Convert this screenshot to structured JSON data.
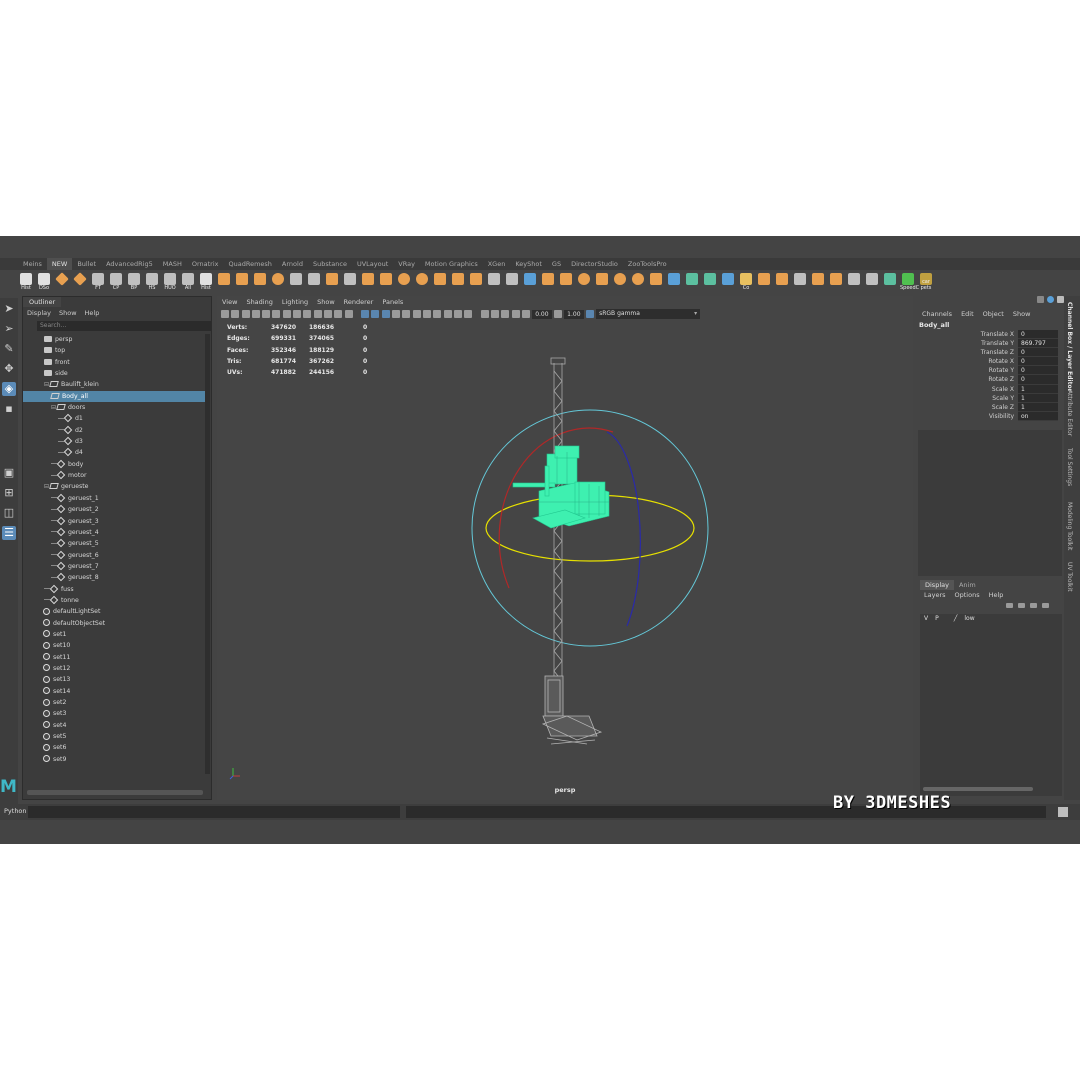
{
  "shelf_tabs": [
    "Meins",
    "NEW",
    "Bullet",
    "AdvancedRig5",
    "MASH",
    "Ornatrix",
    "QuadRemesh",
    "Arnold",
    "Substance",
    "UVLayout",
    "VRay",
    "Motion Graphics",
    "XGen",
    "KeyShot",
    "GS",
    "DirectorStudio",
    "ZooToolsPro"
  ],
  "active_shelf_tab": "NEW",
  "shelf_icons": [
    {
      "name": "hist-icon",
      "label": "Hist",
      "color": "#e0e0e0"
    },
    {
      "name": "dso-icon",
      "label": "DSo",
      "color": "#e0e0e0"
    },
    {
      "name": "diamond-icon",
      "label": "",
      "color": "#e8a050"
    },
    {
      "name": "diamond-icon",
      "label": "",
      "color": "#e8a050"
    },
    {
      "name": "ft-icon",
      "label": "FT",
      "color": "#c0c0c0"
    },
    {
      "name": "cp-icon",
      "label": "CP",
      "color": "#c0c0c0"
    },
    {
      "name": "bp-icon",
      "label": "BP",
      "color": "#c0c0c0"
    },
    {
      "name": "hs-icon",
      "label": "HS",
      "color": "#c0c0c0"
    },
    {
      "name": "huo-icon",
      "label": "HUO",
      "color": "#c0c0c0"
    },
    {
      "name": "all-icon",
      "label": "All",
      "color": "#c0c0c0"
    },
    {
      "name": "hist-icon",
      "label": "Hist",
      "color": "#e0e0e0"
    },
    {
      "name": "curve-icon",
      "label": "",
      "color": "#e8a050"
    },
    {
      "name": "cube-icon",
      "label": "",
      "color": "#e8a050"
    },
    {
      "name": "cube-icon",
      "label": "",
      "color": "#e8a050"
    },
    {
      "name": "sphere-icon",
      "label": "",
      "color": "#e8a050"
    },
    {
      "name": "grid-icon",
      "label": "",
      "color": "#c0c0c0"
    },
    {
      "name": "grid-icon",
      "label": "",
      "color": "#c0c0c0"
    },
    {
      "name": "bevel-icon",
      "label": "",
      "color": "#e8a050"
    },
    {
      "name": "grid-icon",
      "label": "",
      "color": "#c0c0c0"
    },
    {
      "name": "bridge-icon",
      "label": "",
      "color": "#e8a050"
    },
    {
      "name": "bridge-icon",
      "label": "",
      "color": "#e8a050"
    },
    {
      "name": "sphere-icon",
      "label": "",
      "color": "#e8a050"
    },
    {
      "name": "sphere-icon",
      "label": "",
      "color": "#e8a050"
    },
    {
      "name": "cube-icon",
      "label": "",
      "color": "#e8a050"
    },
    {
      "name": "cube-icon",
      "label": "",
      "color": "#e8a050"
    },
    {
      "name": "plane-icon",
      "label": "",
      "color": "#e8a050"
    },
    {
      "name": "plane-icon",
      "label": "",
      "color": "#c0c0c0"
    },
    {
      "name": "grid-icon",
      "label": "",
      "color": "#c0c0c0"
    },
    {
      "name": "pipe-icon",
      "label": "",
      "color": "#5aa0d8"
    },
    {
      "name": "cube-icon",
      "label": "",
      "color": "#e8a050"
    },
    {
      "name": "cube-icon",
      "label": "",
      "color": "#e8a050"
    },
    {
      "name": "cylinder-icon",
      "label": "",
      "color": "#e8a050"
    },
    {
      "name": "cube-icon",
      "label": "",
      "color": "#e8a050"
    },
    {
      "name": "cylinder-icon",
      "label": "",
      "color": "#e8a050"
    },
    {
      "name": "cylinder-icon",
      "label": "",
      "color": "#e8a050"
    },
    {
      "name": "cube-icon",
      "label": "",
      "color": "#e8a050"
    },
    {
      "name": "pipe-icon",
      "label": "",
      "color": "#5aa0d8"
    },
    {
      "name": "uv-icon",
      "label": "",
      "color": "#5cc0a0"
    },
    {
      "name": "uv-icon",
      "label": "",
      "color": "#5cc0a0"
    },
    {
      "name": "pipe-icon",
      "label": "",
      "color": "#5aa0d8"
    },
    {
      "name": "co-icon",
      "label": "Co",
      "color": "#e8c060"
    },
    {
      "name": "star-icon",
      "label": "",
      "color": "#e8a050"
    },
    {
      "name": "cube-icon",
      "label": "",
      "color": "#e8a050"
    },
    {
      "name": "cube-icon",
      "label": "",
      "color": "#c0c0c0"
    },
    {
      "name": "cube-icon",
      "label": "",
      "color": "#e8a050"
    },
    {
      "name": "cube-icon",
      "label": "",
      "color": "#e8a050"
    },
    {
      "name": "tag-icon",
      "label": "",
      "color": "#c0c0c0"
    },
    {
      "name": "link-icon",
      "label": "",
      "color": "#c0c0c0"
    },
    {
      "name": "frame-icon",
      "label": "",
      "color": "#5cc0a0"
    },
    {
      "name": "speedcut-icon",
      "label": "SpeedC",
      "color": "#50c050"
    },
    {
      "name": "carpets-icon",
      "label": "car pets",
      "color": "#c0a040"
    }
  ],
  "outliner": {
    "tab": "Outliner",
    "menu": [
      "Display",
      "Show",
      "Help"
    ],
    "search_placeholder": "Search...",
    "items": [
      {
        "label": "persp",
        "icon": "cam",
        "indent": 1,
        "expander": ""
      },
      {
        "label": "top",
        "icon": "cam",
        "indent": 1,
        "expander": ""
      },
      {
        "label": "front",
        "icon": "cam",
        "indent": 1,
        "expander": ""
      },
      {
        "label": "side",
        "icon": "cam",
        "indent": 1,
        "expander": ""
      },
      {
        "label": "Baulift_klein",
        "icon": "grp",
        "indent": 1,
        "expander": "⊟"
      },
      {
        "label": "Body_all",
        "icon": "grp",
        "indent": 2,
        "expander": "",
        "selected": true
      },
      {
        "label": "doors",
        "icon": "grp",
        "indent": 2,
        "expander": "⊟"
      },
      {
        "label": "d1",
        "icon": "mesh",
        "indent": 3,
        "expander": ""
      },
      {
        "label": "d2",
        "icon": "mesh",
        "indent": 3,
        "expander": ""
      },
      {
        "label": "d3",
        "icon": "mesh",
        "indent": 3,
        "expander": ""
      },
      {
        "label": "d4",
        "icon": "mesh",
        "indent": 3,
        "expander": ""
      },
      {
        "label": "body",
        "icon": "mesh",
        "indent": 2,
        "expander": ""
      },
      {
        "label": "motor",
        "icon": "mesh",
        "indent": 2,
        "expander": ""
      },
      {
        "label": "gerueste",
        "icon": "grp",
        "indent": 1,
        "expander": "⊟"
      },
      {
        "label": "geruest_1",
        "icon": "mesh",
        "indent": 2,
        "expander": ""
      },
      {
        "label": "geruest_2",
        "icon": "mesh",
        "indent": 2,
        "expander": ""
      },
      {
        "label": "geruest_3",
        "icon": "mesh",
        "indent": 2,
        "expander": ""
      },
      {
        "label": "geruest_4",
        "icon": "mesh",
        "indent": 2,
        "expander": ""
      },
      {
        "label": "geruest_5",
        "icon": "mesh",
        "indent": 2,
        "expander": ""
      },
      {
        "label": "geruest_6",
        "icon": "mesh",
        "indent": 2,
        "expander": ""
      },
      {
        "label": "geruest_7",
        "icon": "mesh",
        "indent": 2,
        "expander": ""
      },
      {
        "label": "geruest_8",
        "icon": "mesh",
        "indent": 2,
        "expander": ""
      },
      {
        "label": "fuss",
        "icon": "mesh",
        "indent": 1,
        "expander": ""
      },
      {
        "label": "tonne",
        "icon": "mesh",
        "indent": 1,
        "expander": ""
      },
      {
        "label": "defaultLightSet",
        "icon": "set",
        "indent": 0,
        "expander": ""
      },
      {
        "label": "defaultObjectSet",
        "icon": "set",
        "indent": 0,
        "expander": ""
      },
      {
        "label": "set1",
        "icon": "set",
        "indent": 0,
        "expander": ""
      },
      {
        "label": "set10",
        "icon": "set",
        "indent": 0,
        "expander": ""
      },
      {
        "label": "set11",
        "icon": "set",
        "indent": 0,
        "expander": ""
      },
      {
        "label": "set12",
        "icon": "set",
        "indent": 0,
        "expander": ""
      },
      {
        "label": "set13",
        "icon": "set",
        "indent": 0,
        "expander": ""
      },
      {
        "label": "set14",
        "icon": "set",
        "indent": 0,
        "expander": ""
      },
      {
        "label": "set2",
        "icon": "set",
        "indent": 0,
        "expander": ""
      },
      {
        "label": "set3",
        "icon": "set",
        "indent": 0,
        "expander": ""
      },
      {
        "label": "set4",
        "icon": "set",
        "indent": 0,
        "expander": ""
      },
      {
        "label": "set5",
        "icon": "set",
        "indent": 0,
        "expander": ""
      },
      {
        "label": "set6",
        "icon": "set",
        "indent": 0,
        "expander": ""
      },
      {
        "label": "set9",
        "icon": "set",
        "indent": 0,
        "expander": ""
      }
    ]
  },
  "viewport": {
    "menu": [
      "View",
      "Shading",
      "Lighting",
      "Show",
      "Renderer",
      "Panels"
    ],
    "exposure": "0.00",
    "gamma": "1.00",
    "color_space": "sRGB gamma",
    "camera": "persp",
    "hud": [
      {
        "key": "Verts:",
        "v1": "347620",
        "v2": "186636",
        "v3": "0"
      },
      {
        "key": "Edges:",
        "v1": "699331",
        "v2": "374065",
        "v3": "0"
      },
      {
        "key": "Faces:",
        "v1": "352346",
        "v2": "188129",
        "v3": "0"
      },
      {
        "key": "Tris:",
        "v1": "681774",
        "v2": "367262",
        "v3": "0"
      },
      {
        "key": "UVs:",
        "v1": "471882",
        "v2": "244156",
        "v3": "0"
      }
    ],
    "selection_color": "#3ef0b0"
  },
  "channel_box": {
    "menu": [
      "Channels",
      "Edit",
      "Object",
      "Show"
    ],
    "object": "Body_all",
    "attrs": [
      {
        "name": "Translate X",
        "value": "0"
      },
      {
        "name": "Translate Y",
        "value": "869.797"
      },
      {
        "name": "Translate Z",
        "value": "0"
      },
      {
        "name": "Rotate X",
        "value": "0"
      },
      {
        "name": "Rotate Y",
        "value": "0"
      },
      {
        "name": "Rotate Z",
        "value": "0"
      },
      {
        "name": "Scale X",
        "value": "1"
      },
      {
        "name": "Scale Y",
        "value": "1"
      },
      {
        "name": "Scale Z",
        "value": "1"
      },
      {
        "name": "Visibility",
        "value": "on"
      }
    ]
  },
  "layer_editor": {
    "tabs": [
      "Display",
      "Anim"
    ],
    "menu": [
      "Layers",
      "Options",
      "Help"
    ],
    "layers": [
      {
        "v": "V",
        "p": "P",
        "name": "low"
      }
    ]
  },
  "side_tabs": [
    "Channel Box / Layer Editor",
    "Attribute Editor",
    "Tool Settings",
    "Modeling Toolkit",
    "UV Toolkit"
  ],
  "python_label": "Python",
  "watermark": "BY 3DMESHES"
}
